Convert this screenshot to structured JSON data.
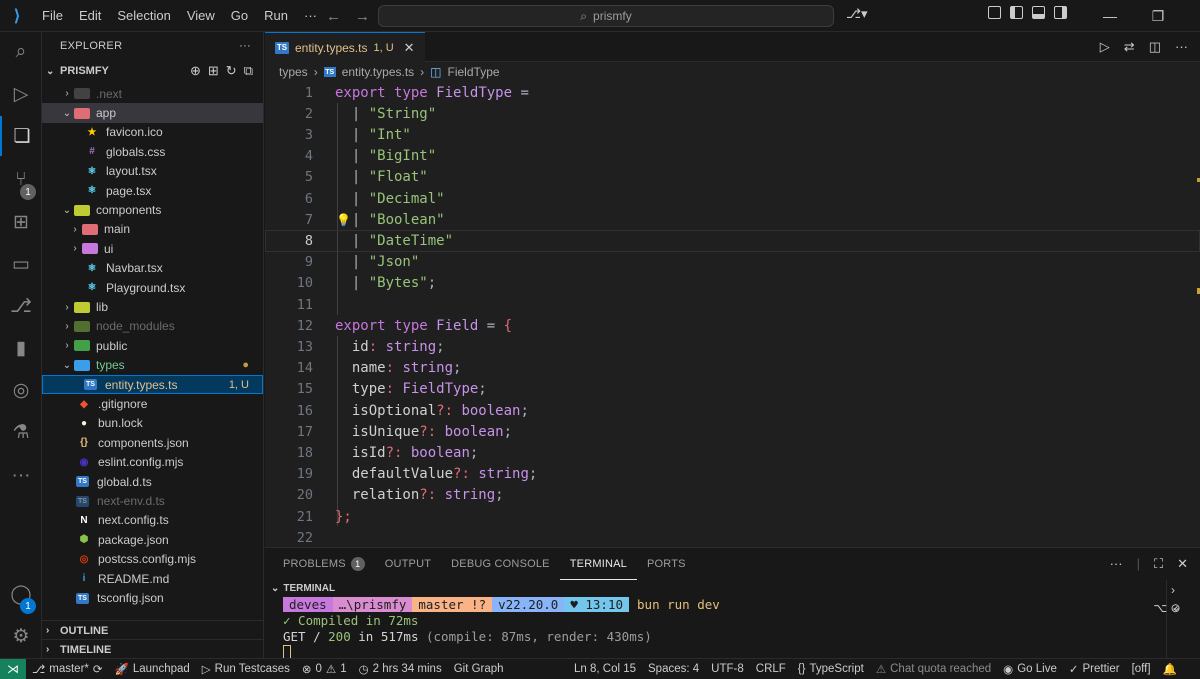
{
  "menu": [
    "File",
    "Edit",
    "Selection",
    "View",
    "Go",
    "Run",
    "···"
  ],
  "command_center": "prismfy",
  "explorer": {
    "title": "EXPLORER",
    "project": "PRISMFY",
    "tree": [
      {
        "name": ".next",
        "kind": "folder",
        "depth": 0,
        "open": false,
        "dim": true,
        "color": "#6b6b6b"
      },
      {
        "name": "app",
        "kind": "folder",
        "depth": 0,
        "open": true,
        "sel": true,
        "color": "#e06c75"
      },
      {
        "name": "favicon.ico",
        "kind": "file",
        "depth": 1,
        "icon": "★",
        "color": "#ffcc00"
      },
      {
        "name": "globals.css",
        "kind": "file",
        "depth": 1,
        "icon": "#",
        "color": "#a074c4"
      },
      {
        "name": "layout.tsx",
        "kind": "file",
        "depth": 1,
        "icon": "⚛",
        "color": "#61dafb"
      },
      {
        "name": "page.tsx",
        "kind": "file",
        "depth": 1,
        "icon": "⚛",
        "color": "#61dafb"
      },
      {
        "name": "components",
        "kind": "folder",
        "depth": 0,
        "open": true,
        "color": "#c0ca33"
      },
      {
        "name": "main",
        "kind": "folder",
        "depth": 1,
        "open": false,
        "color": "#e06c75"
      },
      {
        "name": "ui",
        "kind": "folder",
        "depth": 1,
        "open": false,
        "color": "#c678dd"
      },
      {
        "name": "Navbar.tsx",
        "kind": "file",
        "depth": 1,
        "icon": "⚛",
        "color": "#61dafb"
      },
      {
        "name": "Playground.tsx",
        "kind": "file",
        "depth": 1,
        "icon": "⚛",
        "color": "#61dafb"
      },
      {
        "name": "lib",
        "kind": "folder",
        "depth": 0,
        "open": false,
        "color": "#c0ca33"
      },
      {
        "name": "node_modules",
        "kind": "folder",
        "depth": 0,
        "open": false,
        "dim": true,
        "color": "#8bc34a"
      },
      {
        "name": "public",
        "kind": "folder",
        "depth": 0,
        "open": false,
        "color": "#43a047"
      },
      {
        "name": "types",
        "kind": "folder",
        "depth": 0,
        "open": true,
        "git": true,
        "dot": true,
        "color": "#3b9eea"
      },
      {
        "name": "entity.types.ts",
        "kind": "file",
        "depth": 1,
        "active": true,
        "git": true,
        "status": "1, U",
        "icon": "TS",
        "color": "#3178c6"
      },
      {
        "name": ".gitignore",
        "kind": "file",
        "depth": 0,
        "icon": "◆",
        "color": "#f05133"
      },
      {
        "name": "bun.lock",
        "kind": "file",
        "depth": 0,
        "icon": "●",
        "color": "#fbf0df"
      },
      {
        "name": "components.json",
        "kind": "file",
        "depth": 0,
        "icon": "{}",
        "color": "#e5c07b"
      },
      {
        "name": "eslint.config.mjs",
        "kind": "file",
        "depth": 0,
        "icon": "◉",
        "color": "#4b32c3"
      },
      {
        "name": "global.d.ts",
        "kind": "file",
        "depth": 0,
        "icon": "TS",
        "color": "#3178c6"
      },
      {
        "name": "next-env.d.ts",
        "kind": "file",
        "depth": 0,
        "dim": true,
        "icon": "TS",
        "color": "#3178c6"
      },
      {
        "name": "next.config.ts",
        "kind": "file",
        "depth": 0,
        "icon": "N",
        "color": "#ffffff"
      },
      {
        "name": "package.json",
        "kind": "file",
        "depth": 0,
        "icon": "⬢",
        "color": "#8bc34a"
      },
      {
        "name": "postcss.config.mjs",
        "kind": "file",
        "depth": 0,
        "icon": "◎",
        "color": "#dd3a0a"
      },
      {
        "name": "README.md",
        "kind": "file",
        "depth": 0,
        "icon": "i",
        "color": "#3b9eea"
      },
      {
        "name": "tsconfig.json",
        "kind": "file",
        "depth": 0,
        "icon": "TS",
        "color": "#3178c6"
      }
    ],
    "outline": "OUTLINE",
    "timeline": "TIMELINE"
  },
  "tab": {
    "name": "entity.types.ts",
    "status": "1, U"
  },
  "breadcrumb": [
    "types",
    "entity.types.ts",
    "FieldType"
  ],
  "code_lines": [
    [
      [
        "kw",
        "export "
      ],
      [
        "kw",
        "type "
      ],
      [
        "ty",
        "FieldType"
      ],
      [
        "pu",
        " ="
      ]
    ],
    [
      [
        "pu",
        "  | "
      ],
      [
        "st",
        "\"String\""
      ]
    ],
    [
      [
        "pu",
        "  | "
      ],
      [
        "st",
        "\"Int\""
      ]
    ],
    [
      [
        "pu",
        "  | "
      ],
      [
        "st",
        "\"BigInt\""
      ]
    ],
    [
      [
        "pu",
        "  | "
      ],
      [
        "st",
        "\"Float\""
      ]
    ],
    [
      [
        "pu",
        "  | "
      ],
      [
        "st",
        "\"Decimal\""
      ]
    ],
    [
      [
        "pu",
        "  | "
      ],
      [
        "st",
        "\"Boolean\""
      ]
    ],
    [
      [
        "pu",
        "  | "
      ],
      [
        "st",
        "\"DateTime\""
      ]
    ],
    [
      [
        "pu",
        "  | "
      ],
      [
        "st",
        "\"Json\""
      ]
    ],
    [
      [
        "pu",
        "  | "
      ],
      [
        "st",
        "\"Bytes\""
      ],
      [
        "pu",
        ";"
      ]
    ],
    [],
    [
      [
        "kw",
        "export "
      ],
      [
        "kw",
        "type "
      ],
      [
        "ty",
        "Field"
      ],
      [
        "pu",
        " = "
      ],
      [
        "pn",
        "{"
      ]
    ],
    [
      [
        "fd",
        "  id"
      ],
      [
        "pn",
        ": "
      ],
      [
        "ty",
        "string"
      ],
      [
        "pu",
        ";"
      ]
    ],
    [
      [
        "fd",
        "  name"
      ],
      [
        "pn",
        ": "
      ],
      [
        "ty",
        "string"
      ],
      [
        "pu",
        ";"
      ]
    ],
    [
      [
        "fd",
        "  type"
      ],
      [
        "pn",
        ": "
      ],
      [
        "ty",
        "FieldType"
      ],
      [
        "pu",
        ";"
      ]
    ],
    [
      [
        "fd",
        "  isOptional"
      ],
      [
        "pn",
        "?: "
      ],
      [
        "ty",
        "boolean"
      ],
      [
        "pu",
        ";"
      ]
    ],
    [
      [
        "fd",
        "  isUnique"
      ],
      [
        "pn",
        "?: "
      ],
      [
        "ty",
        "boolean"
      ],
      [
        "pu",
        ";"
      ]
    ],
    [
      [
        "fd",
        "  isId"
      ],
      [
        "pn",
        "?: "
      ],
      [
        "ty",
        "boolean"
      ],
      [
        "pu",
        ";"
      ]
    ],
    [
      [
        "fd",
        "  defaultValue"
      ],
      [
        "pn",
        "?: "
      ],
      [
        "ty",
        "string"
      ],
      [
        "pu",
        ";"
      ]
    ],
    [
      [
        "fd",
        "  relation"
      ],
      [
        "pn",
        "?: "
      ],
      [
        "ty",
        "string"
      ],
      [
        "pu",
        ";"
      ]
    ],
    [
      [
        "pn",
        "};"
      ]
    ],
    []
  ],
  "current_line": 8,
  "panel": {
    "tabs": [
      "PROBLEMS",
      "OUTPUT",
      "DEBUG CONSOLE",
      "TERMINAL",
      "PORTS"
    ],
    "problems_count": "1",
    "active": "TERMINAL",
    "terminal_title": "TERMINAL",
    "prompt": {
      "user": "deves",
      "path": "…\\prismfy",
      "branch": "master !?",
      "node": "v22.20.0",
      "time": "♥ 13:10"
    },
    "command": "bun run dev",
    "out1": "✓ Compiled in 72ms",
    "out2_a": "GET / ",
    "out2_code": "200",
    "out2_b": " in 517ms ",
    "out2_c": "(compile: 87ms, render: 430ms)"
  },
  "status": {
    "branch": "master*",
    "launchpad": "Launchpad",
    "run_testcases": "Run Testcases",
    "errors": "0",
    "warnings": "1",
    "time": "2 hrs 34 mins",
    "git_graph": "Git Graph",
    "position": "Ln 8, Col 15",
    "spaces": "Spaces: 4",
    "encoding": "UTF-8",
    "eol": "CRLF",
    "language": "TypeScript",
    "chat": "Chat quota reached",
    "golive": "Go Live",
    "prettier": "Prettier",
    "off": "[off]"
  },
  "colors": {
    "accent": "#0078d4",
    "statusRemote": "#16825d"
  }
}
